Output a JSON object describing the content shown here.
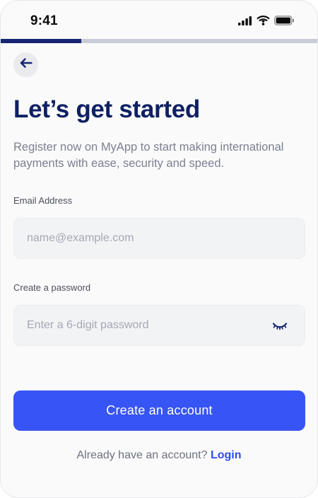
{
  "status_bar": {
    "time": "9:41",
    "icons": [
      "cellular-signal-icon",
      "wifi-icon",
      "battery-icon"
    ]
  },
  "progress": {
    "fraction": 0.255,
    "fill_color": "#152572",
    "track_color": "#C9CCD6"
  },
  "back_button": {
    "icon": "arrow-left-icon"
  },
  "header": {
    "title": "Let’s get started",
    "subtitle": "Register now on MyApp to start making international payments with ease, security and speed."
  },
  "form": {
    "email": {
      "label": "Email Address",
      "placeholder": "name@example.com",
      "value": ""
    },
    "password": {
      "label": "Create a password",
      "placeholder": "Enter a 6-digit password",
      "value": "",
      "toggle_icon": "eye-closed-icon"
    }
  },
  "actions": {
    "primary_label": "Create an account",
    "login_prompt": "Already have an account?",
    "login_link": "Login"
  },
  "colors": {
    "title": "#0F2063",
    "primary": "#3755F5",
    "link": "#2F4EE8"
  }
}
